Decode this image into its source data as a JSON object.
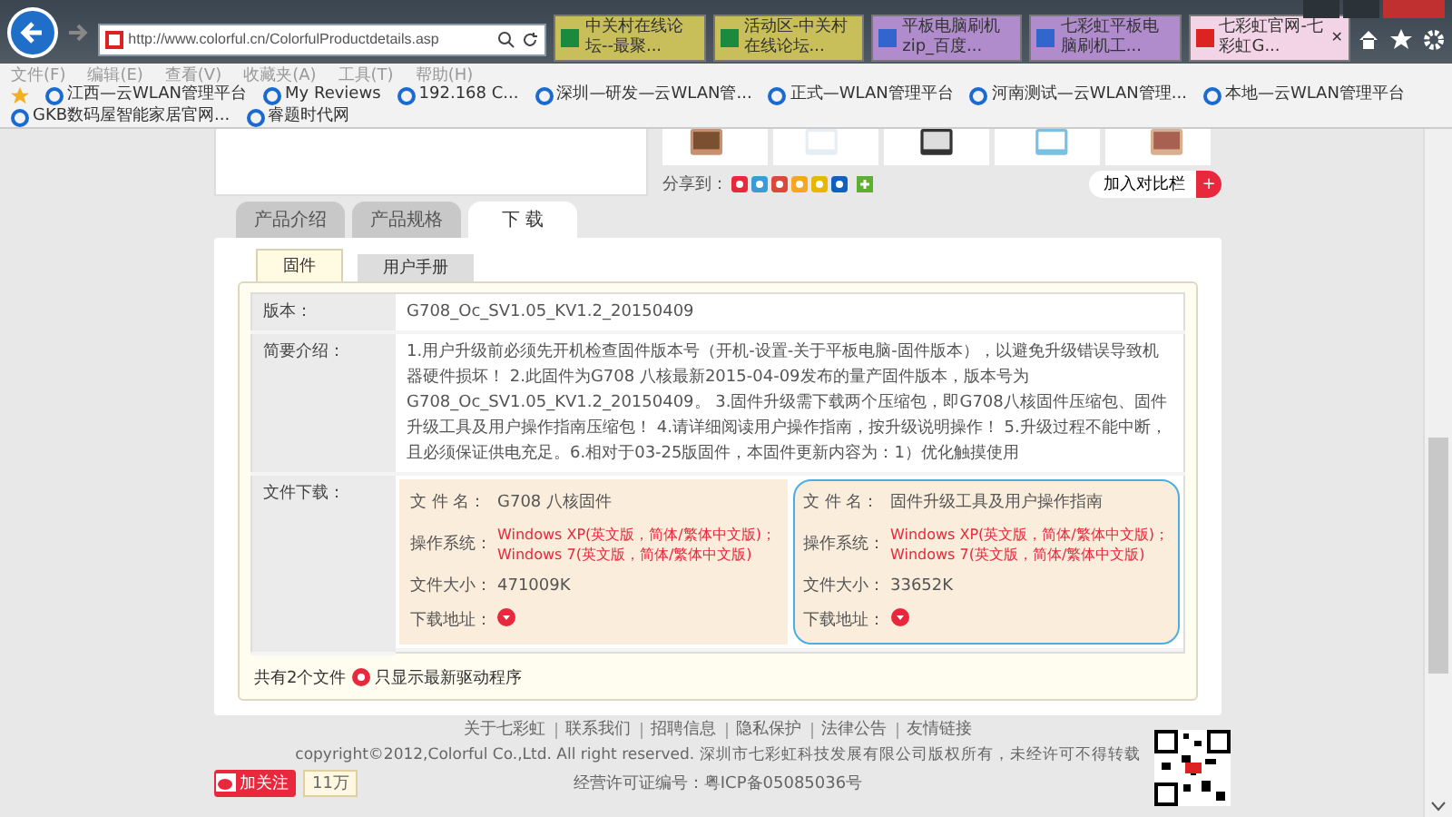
{
  "browser": {
    "tab_close": "✕",
    "address": "http://www.colorful.cn/ColorfulProductdetails.asp",
    "tabs": [
      {
        "title": "中关村在线论坛--最聚...",
        "color": "#c9bf5a",
        "selected": false
      },
      {
        "title": "活动区-中关村在线论坛...",
        "color": "#c9bf5a",
        "selected": false
      },
      {
        "title": "平板电脑刷机 zip_百度...",
        "color": "#b08ccc",
        "selected": false
      },
      {
        "title": "七彩虹平板电脑刷机工...",
        "color": "#b08ccc",
        "selected": false
      },
      {
        "title": "七彩虹官网-七彩虹G...",
        "color": "#f3d3e6",
        "selected": true
      }
    ],
    "menu": [
      "文件(F)",
      "编辑(E)",
      "查看(V)",
      "收藏夹(A)",
      "工具(T)",
      "帮助(H)"
    ],
    "favorites": [
      "江西—云WLAN管理平台",
      "My Reviews",
      "192.168 C...",
      "深圳—研发—云WLAN管...",
      "正式—WLAN管理平台",
      "河南测试—云WLAN管理...",
      "本地—云WLAN管理平台",
      "GKB数码屋智能家居官网...",
      "睿题时代网"
    ]
  },
  "page": {
    "share_label": "分享到：",
    "compare_button": "加入对比栏",
    "compare_plus": "+",
    "product_tabs": [
      {
        "label": "产品介绍",
        "selected": false
      },
      {
        "label": "产品规格",
        "selected": false
      },
      {
        "label": "下 载",
        "selected": true
      }
    ],
    "sub_tabs": [
      {
        "label": "固件",
        "selected": true
      },
      {
        "label": "用户手册",
        "selected": false
      }
    ],
    "version_label": "版本：",
    "version": "G708_Oc_SV1.05_KV1.2_20150409",
    "summary_label": "简要介绍：",
    "summary": "1.用户升级前必须先开机检查固件版本号（开机-设置-关于平板电脑-固件版本），以避免升级错误导致机器硬件损坏！ 2.此固件为G708 八核最新2015-04-09发布的量产固件版本，版本号为G708_Oc_SV1.05_KV1.2_20150409。 3.固件升级需下载两个压缩包，即G708八核固件压缩包、固件升级工具及用户操作指南压缩包！ 4.请详细阅读用户操作指南，按升级说明操作！ 5.升级过程不能中断，且必须保证供电充足。6.相对于03-25版固件，本固件更新内容为：1）优化触摸使用",
    "files_label": "文件下载：",
    "files": [
      {
        "name_label": "文 件 名：",
        "name": "G708 八核固件",
        "os_label": "操作系统：",
        "os": [
          "Windows XP(英文版，简体/繁体中文版)；",
          "Windows 7(英文版，简体/繁体中文版)"
        ],
        "size_label": "文件大小：",
        "size": "471009K",
        "url_label": "下载地址：",
        "highlighted": false
      },
      {
        "name_label": "文 件 名：",
        "name": "固件升级工具及用户操作指南",
        "os_label": "操作系统：",
        "os": [
          "Windows XP(英文版，简体/繁体中文版)；",
          "Windows 7(英文版，简体/繁体中文版)"
        ],
        "size_label": "文件大小：",
        "size": "33652K",
        "url_label": "下载地址：",
        "highlighted": true
      }
    ],
    "file_count": "共有2个文件",
    "filter_label": "只显示最新驱动程序"
  },
  "footer": {
    "links": [
      "关于七彩虹",
      "联系我们",
      "招聘信息",
      "隐私保护",
      "法律公告",
      "友情链接"
    ],
    "copyright": "copyright©2012,Colorful Co.,Ltd. All right reserved. 深圳市七彩虹科技发展有限公司版权所有，未经许可不得转载",
    "license": "经营许可证编号：粤ICP备05085036号",
    "follow_button": "加关注",
    "follower_count": "11万"
  }
}
